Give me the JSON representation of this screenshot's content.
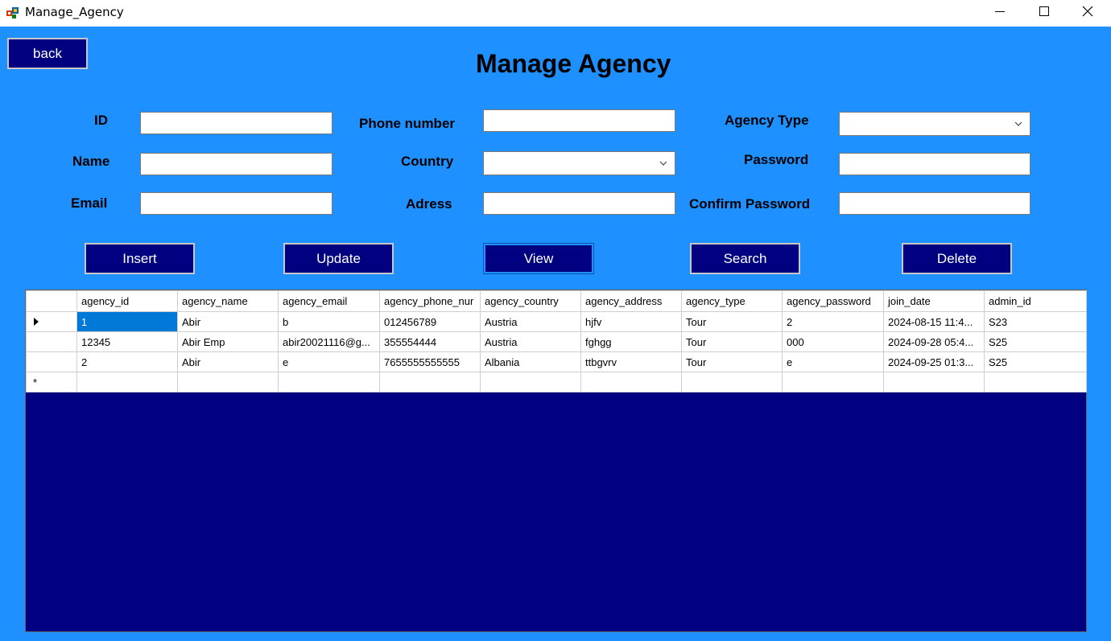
{
  "window": {
    "title": "Manage_Agency"
  },
  "back_label": "back",
  "page_title": "Manage Agency",
  "labels": {
    "id": "ID",
    "name": "Name",
    "email": "Email",
    "phone": "Phone number",
    "country": "Country",
    "address": "Adress",
    "agency_type": "Agency Type",
    "password": "Password",
    "confirm_password": "Confirm Password"
  },
  "fields": {
    "id": "",
    "name": "",
    "email": "",
    "phone": "",
    "country": "",
    "address": "",
    "agency_type": "",
    "password": "",
    "confirm_password": ""
  },
  "buttons": {
    "insert": "Insert",
    "update": "Update",
    "view": "View",
    "search": "Search",
    "delete": "Delete"
  },
  "grid": {
    "columns": [
      "agency_id",
      "agency_name",
      "agency_email",
      "agency_phone_nur",
      "agency_country",
      "agency_address",
      "agency_type",
      "agency_password",
      "join_date",
      "admin_id"
    ],
    "rows": [
      [
        "1",
        "Abir",
        "b",
        "012456789",
        "Austria",
        "hjfv",
        "Tour",
        "2",
        "2024-08-15 11:4...",
        "S23"
      ],
      [
        "12345",
        "Abir Emp",
        "abir20021116@g...",
        "355554444",
        "Austria",
        "fghgg",
        "Tour",
        "000",
        "2024-09-28 05:4...",
        "S25"
      ],
      [
        "2",
        "Abir",
        "e",
        "7655555555555",
        "Albania",
        "ttbgvrv",
        "Tour",
        "e",
        "2024-09-25 01:3...",
        "S25"
      ]
    ],
    "new_row_marker": "*"
  }
}
